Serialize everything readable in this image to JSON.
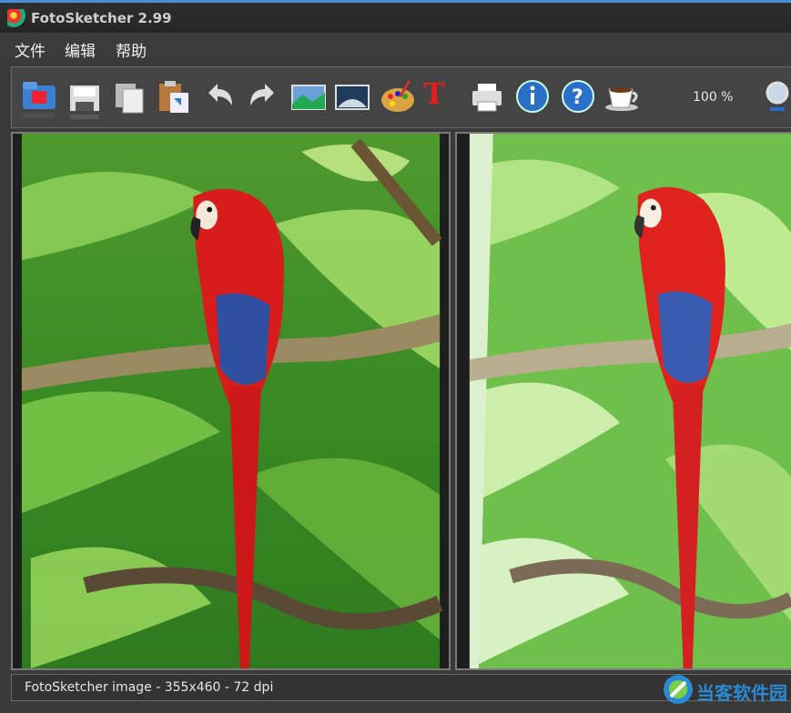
{
  "app": {
    "title": "FotoSketcher 2.99"
  },
  "menu": {
    "items": [
      "文件",
      "编辑",
      "帮助"
    ]
  },
  "toolbar": {
    "tools": [
      "open-folder-icon",
      "save-icon",
      "copy-icon",
      "paste-icon",
      "undo-icon",
      "redo-icon",
      "image-crop-icon",
      "landscape-image-icon",
      "palette-icon",
      "text-tool-icon",
      "print-icon",
      "info-icon",
      "help-icon",
      "coffee-cup-icon",
      "zoom-icon"
    ],
    "zoom": "100 %"
  },
  "status": {
    "text": "FotoSketcher image - 355x460 - 72 dpi"
  },
  "watermark": {
    "text": "当客软件园"
  },
  "colors": {
    "accent": "#4a90d9",
    "parrot_red": "#d81b1b",
    "foliage": "#3f9b2a"
  }
}
